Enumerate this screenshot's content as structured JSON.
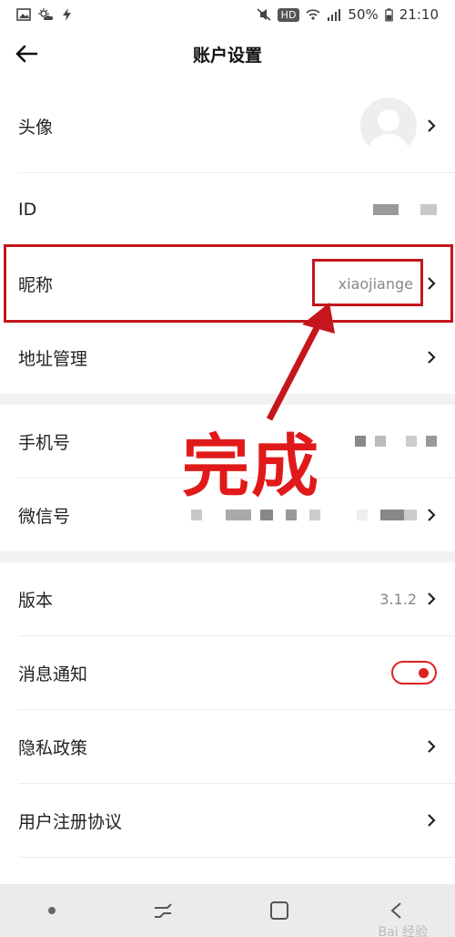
{
  "status_bar": {
    "hd_label": "HD",
    "battery": "50%",
    "time": "21:10"
  },
  "header": {
    "title": "账户设置"
  },
  "rows": {
    "avatar": {
      "label": "头像"
    },
    "id": {
      "label": "ID"
    },
    "nickname": {
      "label": "昵称",
      "value": "xiaojiange"
    },
    "address": {
      "label": "地址管理"
    },
    "phone": {
      "label": "手机号"
    },
    "wechat": {
      "label": "微信号"
    },
    "version": {
      "label": "版本",
      "value": "3.1.2"
    },
    "notifications": {
      "label": "消息通知",
      "enabled": true
    },
    "privacy": {
      "label": "隐私政策"
    },
    "agreement": {
      "label": "用户注册协议"
    }
  },
  "annotation": {
    "text": "完成"
  },
  "colors": {
    "accent": "#e02020",
    "annotation": "#c4161c"
  },
  "watermark": {
    "text": "Bai 经验"
  }
}
